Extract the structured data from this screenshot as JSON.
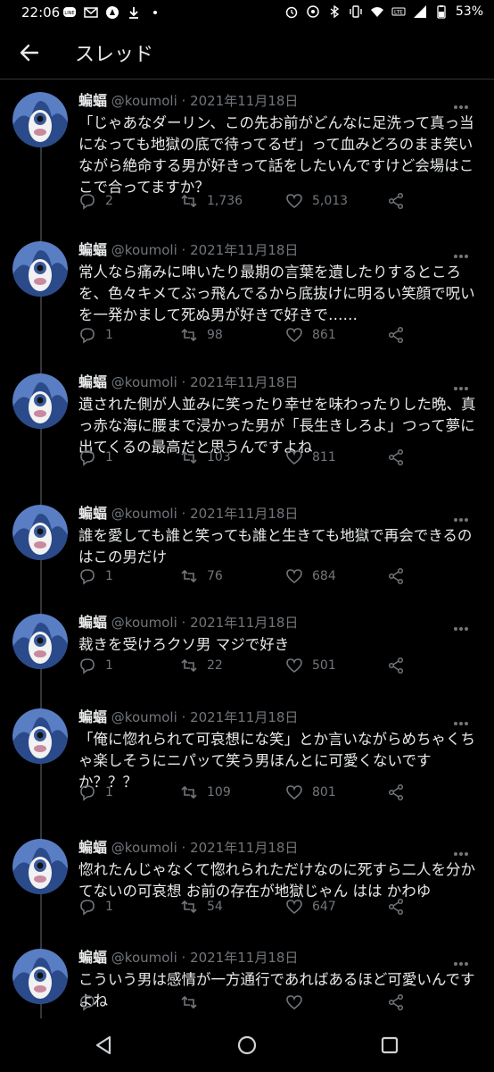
{
  "status_bar": {
    "time": "22:06",
    "battery": "53%",
    "icons": [
      "line-icon",
      "mail-icon",
      "app-icon",
      "download-icon",
      "dot-icon",
      "alarm-icon",
      "sync-icon",
      "bluetooth-icon",
      "vibrate-icon",
      "wifi-icon",
      "lte-icon",
      "signal-icon",
      "battery-icon"
    ]
  },
  "app_bar": {
    "title": "スレッド",
    "back_icon": "back-arrow-icon"
  },
  "author": {
    "name": "蝙蝠",
    "handle": "@koumoli",
    "date": "· 2021年11月18日"
  },
  "tweets": [
    {
      "text": "「じゃあなダーリン、この先お前がどんなに足洗って真っ当になっても地獄の底で待ってるぜ」って血みどろのまま笑いながら絶命する男が好きって話をしたいんですけど会場はここで合ってますか？",
      "replies": "2",
      "retweets": "1,736",
      "likes": "5,013"
    },
    {
      "text": "常人なら痛みに呻いたり最期の言葉を遺したりするところを、色々キメてぶっ飛んでるから底抜けに明るい笑顔で呪いを一発かまして死ぬ男が好きで好きで……",
      "replies": "1",
      "retweets": "98",
      "likes": "861"
    },
    {
      "text": "遺された側が人並みに笑ったり幸せを味わったりした晩、真っ赤な海に腰まで浸かった男が「長生きしろよ」つって夢に出てくるの最高だと思うんですよね",
      "replies": "1",
      "retweets": "103",
      "likes": "811"
    },
    {
      "text": "誰を愛しても誰と笑っても誰と生きても地獄で再会できるのはこの男だけ",
      "replies": "1",
      "retweets": "76",
      "likes": "684"
    },
    {
      "text": "裁きを受けろクソ男 マジで好き",
      "replies": "1",
      "retweets": "22",
      "likes": "501"
    },
    {
      "text": "「俺に惚れられて可哀想にな笑」とか言いながらめちゃくちゃ楽しそうにニパッて笑う男ほんとに可愛くないですか？？？",
      "replies": "1",
      "retweets": "109",
      "likes": "801"
    },
    {
      "text": "惚れたんじゃなくて惚れられただけなのに死すら二人を分かてないの可哀想 お前の存在が地獄じゃん はは かわゆ",
      "replies": "1",
      "retweets": "54",
      "likes": "647"
    },
    {
      "text": "こういう男は感情が一方通行であればあるほど可愛いんですよね",
      "replies": "",
      "retweets": "",
      "likes": ""
    }
  ],
  "nav_bar": {
    "icons": [
      "back-triangle-icon",
      "home-circle-icon",
      "recents-square-icon"
    ]
  },
  "colors": {
    "background": "#000000",
    "text": "#e7e9ea",
    "muted": "#71767b",
    "divider": "#2f3336"
  }
}
